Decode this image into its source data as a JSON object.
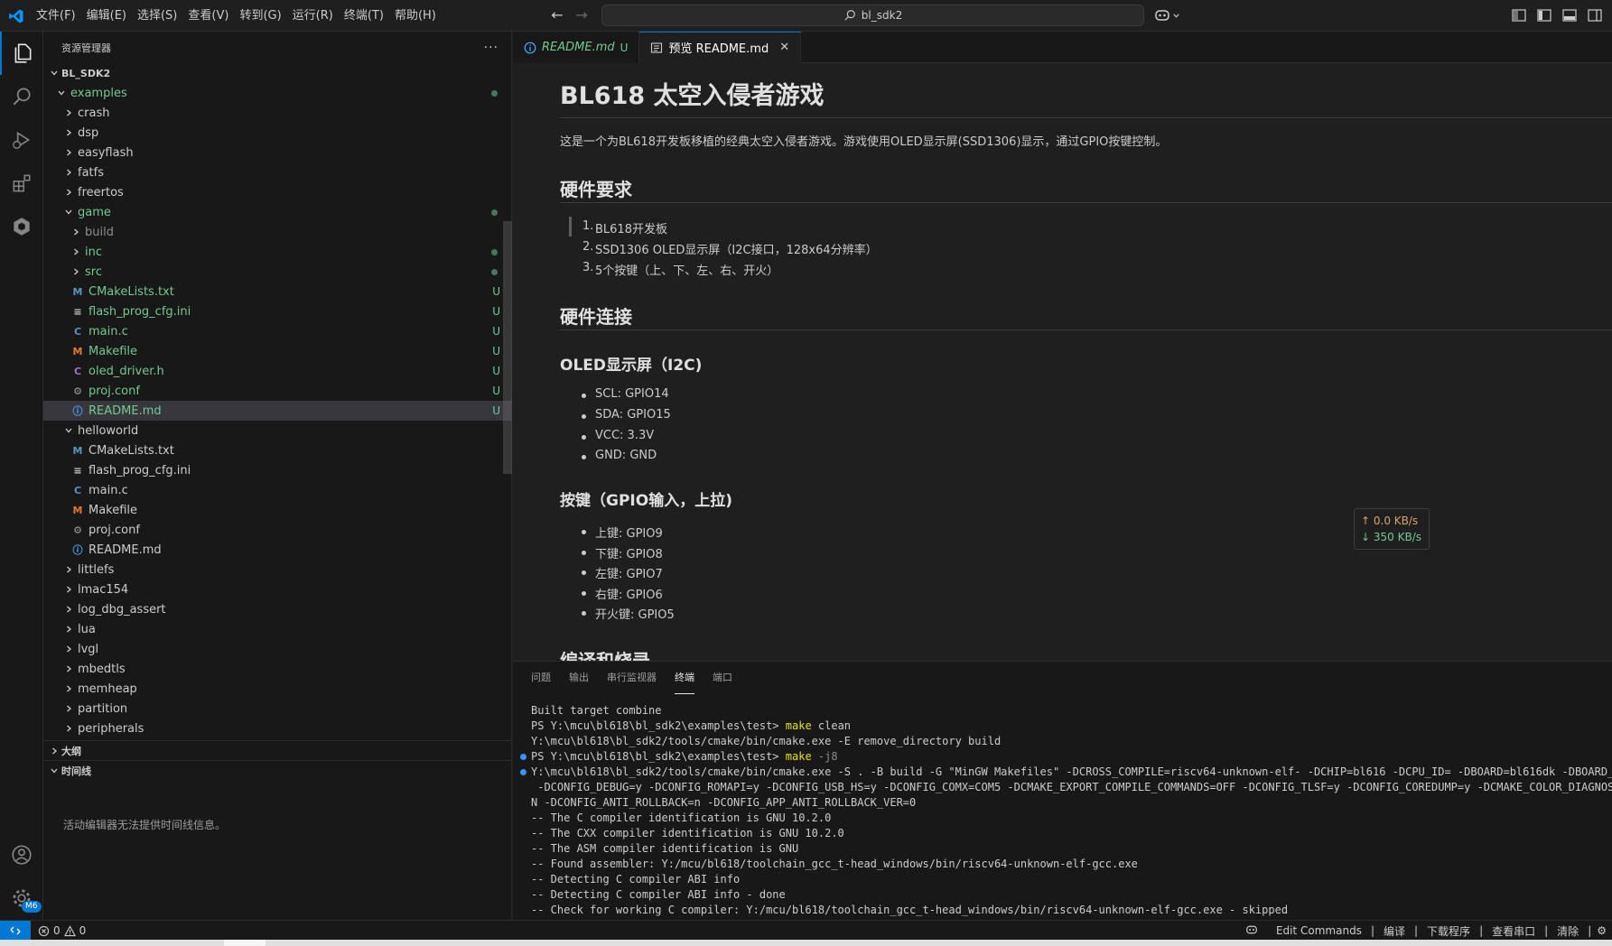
{
  "titlebar": {
    "menus": [
      "文件(F)",
      "编辑(E)",
      "选择(S)",
      "查看(V)",
      "转到(G)",
      "运行(R)",
      "终端(T)",
      "帮助(H)"
    ],
    "search": "bl_sdk2"
  },
  "sidebar": {
    "title": "资源管理器",
    "root": "BL_SDK2",
    "examples_folder": "examples",
    "tree": [
      {
        "label": "crash",
        "type": "folder",
        "depth": 2,
        "color": "def"
      },
      {
        "label": "dsp",
        "type": "folder",
        "depth": 2,
        "color": "def"
      },
      {
        "label": "easyflash",
        "type": "folder",
        "depth": 2,
        "color": "def"
      },
      {
        "label": "fatfs",
        "type": "folder",
        "depth": 2,
        "color": "def"
      },
      {
        "label": "freertos",
        "type": "folder",
        "depth": 2,
        "color": "def"
      },
      {
        "label": "game",
        "type": "folder-open",
        "depth": 2,
        "color": "green",
        "dot": true
      },
      {
        "label": "build",
        "type": "folder",
        "depth": 3,
        "color": "gray"
      },
      {
        "label": "inc",
        "type": "folder",
        "depth": 3,
        "color": "green",
        "dot": true
      },
      {
        "label": "src",
        "type": "folder",
        "depth": 3,
        "color": "green",
        "dot": true
      },
      {
        "label": "CMakeLists.txt",
        "type": "cmake",
        "depth": 3,
        "color": "green",
        "status": "U"
      },
      {
        "label": "flash_prog_cfg.ini",
        "type": "ini",
        "depth": 3,
        "color": "green",
        "status": "U"
      },
      {
        "label": "main.c",
        "type": "c",
        "depth": 3,
        "color": "green",
        "status": "U"
      },
      {
        "label": "Makefile",
        "type": "make",
        "depth": 3,
        "color": "green",
        "status": "U"
      },
      {
        "label": "oled_driver.h",
        "type": "h",
        "depth": 3,
        "color": "green",
        "status": "U"
      },
      {
        "label": "proj.conf",
        "type": "gear",
        "depth": 3,
        "color": "green",
        "status": "U"
      },
      {
        "label": "README.md",
        "type": "info",
        "depth": 3,
        "color": "green",
        "status": "U",
        "selected": true
      },
      {
        "label": "helloworld",
        "type": "folder-open",
        "depth": 2,
        "color": "def"
      },
      {
        "label": "CMakeLists.txt",
        "type": "cmake",
        "depth": 3,
        "color": "def"
      },
      {
        "label": "flash_prog_cfg.ini",
        "type": "ini",
        "depth": 3,
        "color": "def"
      },
      {
        "label": "main.c",
        "type": "c",
        "depth": 3,
        "color": "def"
      },
      {
        "label": "Makefile",
        "type": "make",
        "depth": 3,
        "color": "def"
      },
      {
        "label": "proj.conf",
        "type": "gear",
        "depth": 3,
        "color": "def"
      },
      {
        "label": "README.md",
        "type": "info",
        "depth": 3,
        "color": "def"
      },
      {
        "label": "littlefs",
        "type": "folder",
        "depth": 2,
        "color": "def"
      },
      {
        "label": "lmac154",
        "type": "folder",
        "depth": 2,
        "color": "def"
      },
      {
        "label": "log_dbg_assert",
        "type": "folder",
        "depth": 2,
        "color": "def"
      },
      {
        "label": "lua",
        "type": "folder",
        "depth": 2,
        "color": "def"
      },
      {
        "label": "lvgl",
        "type": "folder",
        "depth": 2,
        "color": "def"
      },
      {
        "label": "mbedtls",
        "type": "folder",
        "depth": 2,
        "color": "def"
      },
      {
        "label": "memheap",
        "type": "folder",
        "depth": 2,
        "color": "def"
      },
      {
        "label": "partition",
        "type": "folder",
        "depth": 2,
        "color": "def"
      },
      {
        "label": "peripherals",
        "type": "folder",
        "depth": 2,
        "color": "def"
      }
    ],
    "outline_title": "大纲",
    "timeline_title": "时间线",
    "timeline_message": "活动编辑器无法提供时间线信息。"
  },
  "tabs": [
    {
      "label": "README.md",
      "status": "U",
      "active": false
    },
    {
      "label": "预览 README.md",
      "active": true
    }
  ],
  "preview": {
    "h1": "BL618 太空入侵者游戏",
    "intro": "这是一个为BL618开发板移植的经典太空入侵者游戏。游戏使用OLED显示屏(SSD1306)显示，通过GPIO按键控制。",
    "hw_req_title": "硬件要求",
    "hw_req": [
      "BL618开发板",
      "SSD1306 OLED显示屏（I2C接口，128x64分辨率）",
      "5个按键（上、下、左、右、开火）"
    ],
    "hw_conn_title": "硬件连接",
    "oled_title": "OLED显示屏（I2C)",
    "oled_pins": [
      "SCL: GPIO14",
      "SDA: GPIO15",
      "VCC: 3.3V",
      "GND: GND"
    ],
    "keys_title": "按键（GPIO输入，上拉)",
    "keys": [
      "上键: GPIO9",
      "下键: GPIO8",
      "左键: GPIO7",
      "右键: GPIO6",
      "开火键: GPIO5"
    ],
    "next_title": "编译和烧录"
  },
  "netspeed": {
    "up": "↑ 0.0 KB/s",
    "down": "↓ 350 KB/s"
  },
  "panel": {
    "tabs": [
      "问题",
      "输出",
      "串行监视器",
      "终端",
      "端口"
    ],
    "active_tab": "终端",
    "terminal": [
      {
        "text": "Built target combine"
      },
      {
        "prompt": "PS Y:\\mcu\\bl618\\bl_sdk2\\examples\\test> ",
        "cmd": "make",
        "args": " clean"
      },
      {
        "text": "Y:\\mcu\\bl618\\bl_sdk2/tools/cmake/bin/cmake.exe -E remove_directory build"
      },
      {
        "prompt": "PS Y:\\mcu\\bl618\\bl_sdk2\\examples\\test> ",
        "cmd": "make",
        "args": " -j8",
        "dot": true,
        "argsGray": true
      },
      {
        "text": "Y:\\mcu\\bl618\\bl_sdk2/tools/cmake/bin/cmake.exe -S . -B build -G \"MinGW Makefiles\" -DCROSS_COMPILE=riscv64-unknown-elf- -DCHIP=bl616 -DCPU_ID= -DBOARD=bl616dk -DBOARD_DIR=",
        "dot": true
      },
      {
        "text": " -DCONFIG_DEBUG=y -DCONFIG_ROMAPI=y -DCONFIG_USB_HS=y -DCONFIG_COMX=COM5 -DCMAKE_EXPORT_COMPILE_COMMANDS=OFF -DCONFIG_TLSF=y -DCONFIG_COREDUMP=y -DCMAKE_COLOR_DIAGNOSTICS=O"
      },
      {
        "text": "N -DCONFIG_ANTI_ROLLBACK=n -DCONFIG_APP_ANTI_ROLLBACK_VER=0"
      },
      {
        "text": "-- The C compiler identification is GNU 10.2.0"
      },
      {
        "text": "-- The CXX compiler identification is GNU 10.2.0"
      },
      {
        "text": "-- The ASM compiler identification is GNU"
      },
      {
        "text": "-- Found assembler: Y:/mcu/bl618/toolchain_gcc_t-head_windows/bin/riscv64-unknown-elf-gcc.exe"
      },
      {
        "text": "-- Detecting C compiler ABI info"
      },
      {
        "text": "-- Detecting C compiler ABI info - done"
      },
      {
        "text": "-- Check for working C compiler: Y:/mcu/bl618/toolchain_gcc_t-head_windows/bin/riscv64-unknown-elf-gcc.exe - skipped"
      }
    ]
  },
  "statusbar": {
    "errors": "0",
    "warnings": "0",
    "items": [
      "Edit Commands",
      "编译",
      "下载程序",
      "查看串口",
      "清除"
    ]
  },
  "activity": {
    "settings_badge": "M6"
  },
  "colors": {
    "accent": "#0078d4",
    "untracked": "#73c991"
  }
}
